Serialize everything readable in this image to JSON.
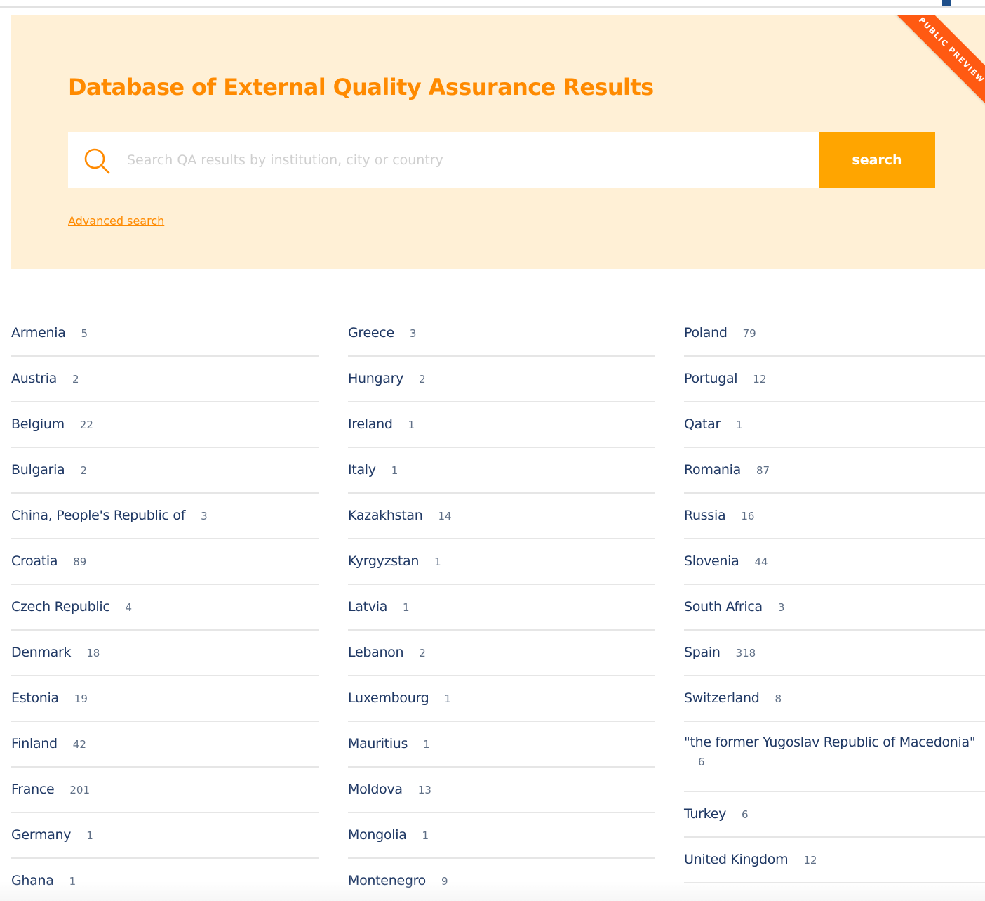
{
  "hero": {
    "title": "Database of External Quality Assurance Results",
    "ribbon": "PUBLIC PREVIEW",
    "search_placeholder": "Search QA results by institution, city or country",
    "search_button": "search",
    "advanced_link": "Advanced search",
    "colors": {
      "background": "#fff0d6",
      "title": "#ff8a00",
      "button": "#ffa500",
      "ribbon": "#ff5a12"
    }
  },
  "columns": [
    [
      {
        "name": "Armenia",
        "count": "5"
      },
      {
        "name": "Austria",
        "count": "2"
      },
      {
        "name": "Belgium",
        "count": "22"
      },
      {
        "name": "Bulgaria",
        "count": "2"
      },
      {
        "name": "China, People's Republic of",
        "count": "3"
      },
      {
        "name": "Croatia",
        "count": "89"
      },
      {
        "name": "Czech Republic",
        "count": "4"
      },
      {
        "name": "Denmark",
        "count": "18"
      },
      {
        "name": "Estonia",
        "count": "19"
      },
      {
        "name": "Finland",
        "count": "42"
      },
      {
        "name": "France",
        "count": "201"
      },
      {
        "name": "Germany",
        "count": "1"
      },
      {
        "name": "Ghana",
        "count": "1"
      }
    ],
    [
      {
        "name": "Greece",
        "count": "3"
      },
      {
        "name": "Hungary",
        "count": "2"
      },
      {
        "name": "Ireland",
        "count": "1"
      },
      {
        "name": "Italy",
        "count": "1"
      },
      {
        "name": "Kazakhstan",
        "count": "14"
      },
      {
        "name": "Kyrgyzstan",
        "count": "1"
      },
      {
        "name": "Latvia",
        "count": "1"
      },
      {
        "name": "Lebanon",
        "count": "2"
      },
      {
        "name": "Luxembourg",
        "count": "1"
      },
      {
        "name": "Mauritius",
        "count": "1"
      },
      {
        "name": "Moldova",
        "count": "13"
      },
      {
        "name": "Mongolia",
        "count": "1"
      },
      {
        "name": "Montenegro",
        "count": "9"
      }
    ],
    [
      {
        "name": "Poland",
        "count": "79"
      },
      {
        "name": "Portugal",
        "count": "12"
      },
      {
        "name": "Qatar",
        "count": "1"
      },
      {
        "name": "Romania",
        "count": "87"
      },
      {
        "name": "Russia",
        "count": "16"
      },
      {
        "name": "Slovenia",
        "count": "44"
      },
      {
        "name": "South Africa",
        "count": "3"
      },
      {
        "name": "Spain",
        "count": "318"
      },
      {
        "name": "Switzerland",
        "count": "8"
      },
      {
        "name": "\"the former Yugoslav Republic of Macedonia\"",
        "count": "6"
      },
      {
        "name": "Turkey",
        "count": "6"
      },
      {
        "name": "United Kingdom",
        "count": "12"
      }
    ]
  ]
}
